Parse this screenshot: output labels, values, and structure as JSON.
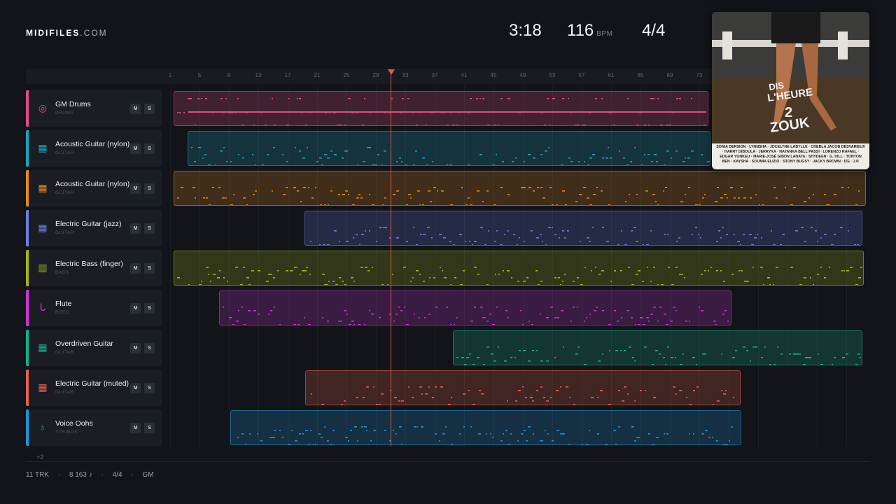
{
  "brand": {
    "name": "MIDIFILES",
    "suffix": ".COM"
  },
  "stats": {
    "time": "3:18",
    "bpm": "116",
    "bpm_unit": "BPM",
    "signature": "4/4"
  },
  "ruler": [
    "1",
    "5",
    "9",
    "13",
    "17",
    "21",
    "25",
    "29",
    "33",
    "37",
    "41",
    "45",
    "49",
    "53",
    "57",
    "61",
    "65",
    "69",
    "73"
  ],
  "tracks": [
    {
      "name": "GM Drums",
      "category": "DRUMS",
      "icon": "drum-icon",
      "color": "#e0507f"
    },
    {
      "name": "Acoustic Guitar (nylon)",
      "category": "GUITAR",
      "icon": "grid-icon",
      "color": "#1ea3bd"
    },
    {
      "name": "Acoustic Guitar (nylon)",
      "category": "GUITAR",
      "icon": "grid-icon",
      "color": "#e58a1f"
    },
    {
      "name": "Electric Guitar (jazz)",
      "category": "GUITAR",
      "icon": "grid-icon",
      "color": "#6b7fe0"
    },
    {
      "name": "Electric Bass (finger)",
      "category": "BASS",
      "icon": "bass-icon",
      "color": "#a7b51d"
    },
    {
      "name": "Flute",
      "category": "REED",
      "icon": "flute-icon",
      "color": "#c935d6"
    },
    {
      "name": "Overdriven Guitar",
      "category": "GUITAR",
      "icon": "grid-icon",
      "color": "#17b08f"
    },
    {
      "name": "Electric Guitar (muted)",
      "category": "GUITAR",
      "icon": "grid-icon",
      "color": "#e4644a"
    },
    {
      "name": "Voice Oohs",
      "category": "STRINGS",
      "icon": "guitar-icon",
      "color": "#1f95d6"
    }
  ],
  "buttons": {
    "mute": "M",
    "solo": "S"
  },
  "more_tracks": "+2",
  "footer": {
    "tracks": "11 TRK",
    "notes": "8 163 ♪",
    "signature": "4/4",
    "standard": "GM",
    "sep": "·"
  },
  "cover": {
    "title1": "DIS",
    "title2": "L'HEURE",
    "title3": "2",
    "title4": "ZOUK",
    "artists": "SONIA DERSION · LYNNSHA · JOCELYNE LABYLLE · CHEBLA JACOB DESVARIEUX · HARRY DIBOULA · JERRYKA · NAYANKA BELL PASSI · LORENZO RAFAEL · EDGAR YONKEU · MARIE-JOSÉ GIBON LANATA · SHYDEEN · G. KILL · TONTON BEN · KAYSHA · SOUMIA ELIZIO · STONY BUGSY · JACKY BROWN · IZE · J.P."
  }
}
